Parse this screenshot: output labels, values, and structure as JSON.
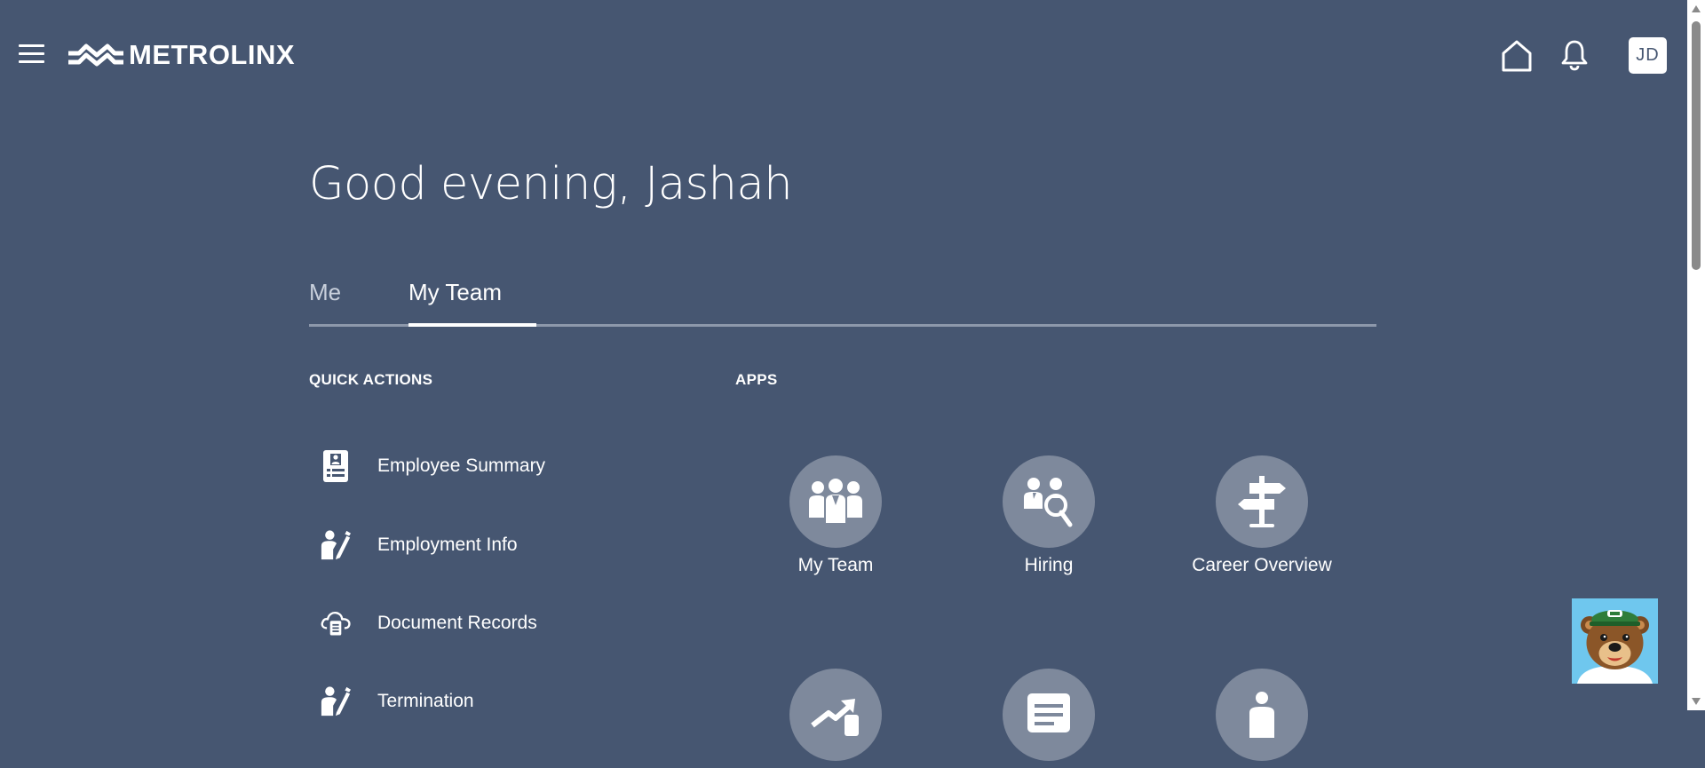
{
  "header": {
    "brand": "METROLINX",
    "avatar_initials": "JD",
    "icons": [
      "menu-icon",
      "home-icon",
      "bell-icon"
    ]
  },
  "greeting": "Good evening, Jashah",
  "tabs": [
    {
      "label": "Me",
      "active": false
    },
    {
      "label": "My Team",
      "active": true
    }
  ],
  "quick_actions": {
    "heading": "QUICK ACTIONS",
    "items": [
      {
        "label": "Employee Summary",
        "icon": "id-badge-icon"
      },
      {
        "label": "Employment Info",
        "icon": "person-edit-icon"
      },
      {
        "label": "Document Records",
        "icon": "cloud-document-icon"
      },
      {
        "label": "Termination",
        "icon": "person-edit-icon"
      }
    ]
  },
  "apps": {
    "heading": "APPS",
    "items": [
      {
        "label": "My Team",
        "icon": "team-icon"
      },
      {
        "label": "Hiring",
        "icon": "hiring-search-icon"
      },
      {
        "label": "Career Overview",
        "icon": "signpost-icon"
      },
      {
        "label": "",
        "icon": "trend-arrow-icon"
      },
      {
        "label": "",
        "icon": "list-form-icon"
      },
      {
        "label": "",
        "icon": "person-info-icon"
      }
    ]
  },
  "colors": {
    "background": "#465671",
    "app_circle": "#7e899c",
    "tab_underline": "#8d98ab",
    "chatbot_bg": "#6fc7ee"
  }
}
